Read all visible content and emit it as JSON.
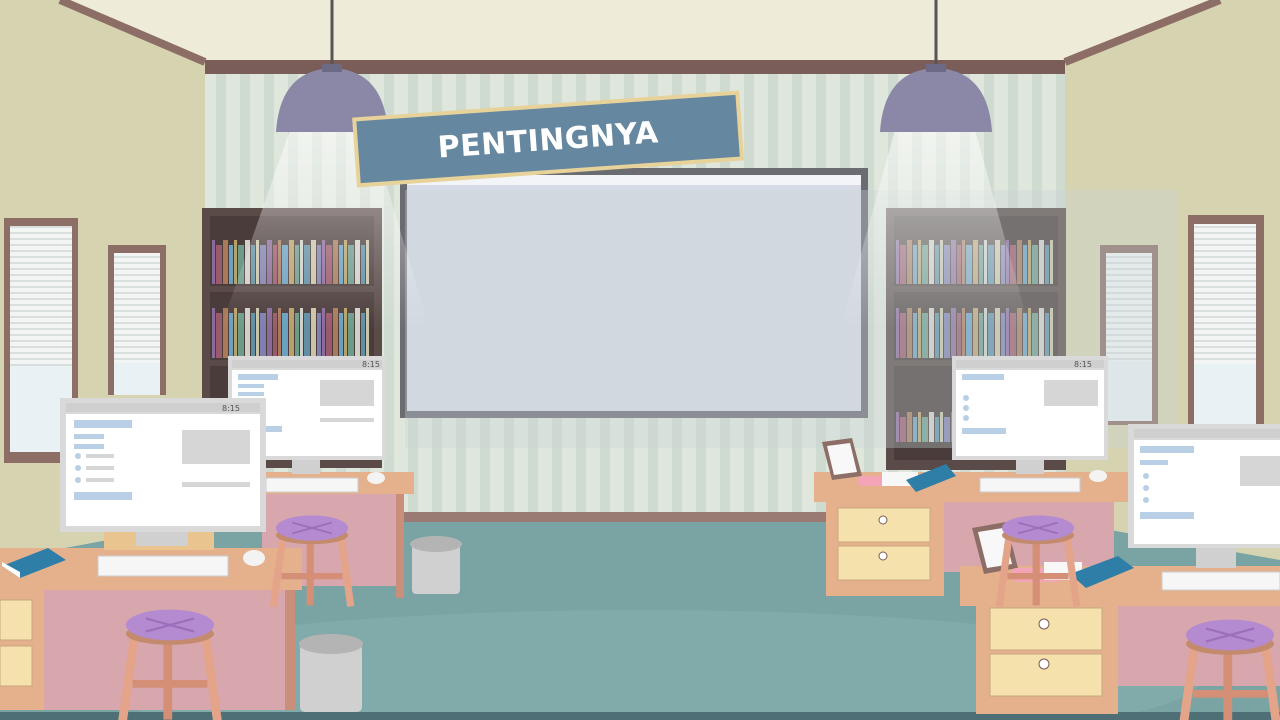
{
  "sign": {
    "title": "PENTINGNYA"
  },
  "monitors": [
    {
      "clock": "8:15"
    },
    {
      "clock": "8:15"
    },
    {
      "clock": "8:15"
    },
    {
      "clock": ""
    }
  ],
  "colors": {
    "wall_back": "#dfe6dc",
    "wall_side": "#d6d3b0",
    "floor": "#7aa3a3",
    "sign": "#65879f",
    "shelf": "#5a4a48",
    "desk_top": "#e4b18c",
    "stool_cushion": "#b48ad0",
    "lamp": "#8b87a6"
  }
}
